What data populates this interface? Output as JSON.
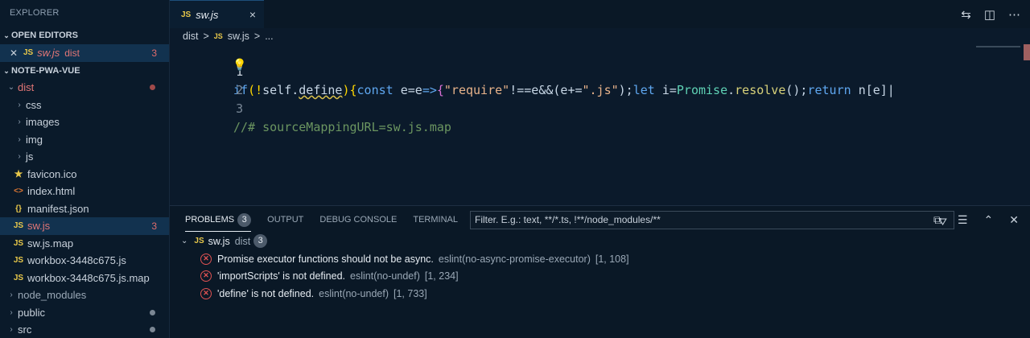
{
  "sidebar": {
    "title": "EXPLORER",
    "open_editors": {
      "label": "OPEN EDITORS",
      "items": [
        {
          "icon": "JS",
          "name": "sw.js",
          "folder": "dist",
          "count": "3"
        }
      ]
    },
    "project": {
      "label": "NOTE-PWA-VUE",
      "tree": [
        {
          "label": "dist",
          "type": "folder-open"
        },
        {
          "label": "css",
          "type": "folder"
        },
        {
          "label": "images",
          "type": "folder"
        },
        {
          "label": "img",
          "type": "folder"
        },
        {
          "label": "js",
          "type": "folder"
        },
        {
          "label": "favicon.ico",
          "type": "star"
        },
        {
          "label": "index.html",
          "type": "html"
        },
        {
          "label": "manifest.json",
          "type": "json"
        },
        {
          "label": "sw.js",
          "type": "js",
          "count": "3"
        },
        {
          "label": "sw.js.map",
          "type": "js"
        },
        {
          "label": "workbox-3448c675.js",
          "type": "js"
        },
        {
          "label": "workbox-3448c675.js.map",
          "type": "js"
        },
        {
          "label": "node_modules",
          "type": "folder"
        },
        {
          "label": "public",
          "type": "folder"
        },
        {
          "label": "src",
          "type": "folder"
        }
      ]
    }
  },
  "editor": {
    "tab": {
      "icon": "JS",
      "name": "sw.js",
      "close": "×"
    },
    "breadcrumb": [
      "dist",
      ">",
      "JS",
      "sw.js",
      ">",
      "..."
    ],
    "lines": [
      "1",
      "2",
      "3"
    ],
    "code": {
      "l1": [
        "if",
        "(!",
        "self",
        ".",
        "define",
        "){",
        "const ",
        "e",
        "=",
        "e",
        "=>",
        "{",
        "\"require\"",
        "!==",
        "e",
        "&&(",
        "e",
        "+=",
        "\".js\"",
        ");",
        "let ",
        "i",
        "=",
        "Promise",
        ".",
        "resolve",
        "();",
        "return ",
        "n",
        "[",
        "e",
        "]|"
      ],
      "l2_comment": "//# sourceMappingURL=sw.js.map"
    }
  },
  "panel": {
    "tabs": [
      {
        "label": "PROBLEMS",
        "count": "3"
      },
      {
        "label": "OUTPUT"
      },
      {
        "label": "DEBUG CONSOLE"
      },
      {
        "label": "TERMINAL"
      }
    ],
    "filter_placeholder": "Filter. E.g.: text, **/*.ts, !**/node_modules/**",
    "group": {
      "icon": "JS",
      "file": "sw.js",
      "folder": "dist",
      "count": "3"
    },
    "problems": [
      {
        "msg": "Promise executor functions should not be async.",
        "source": "eslint(no-async-promise-executor)",
        "pos": "[1, 108]"
      },
      {
        "msg": "'importScripts' is not defined.",
        "source": "eslint(no-undef)",
        "pos": "[1, 234]"
      },
      {
        "msg": "'define' is not defined.",
        "source": "eslint(no-undef)",
        "pos": "[1, 733]"
      }
    ]
  }
}
